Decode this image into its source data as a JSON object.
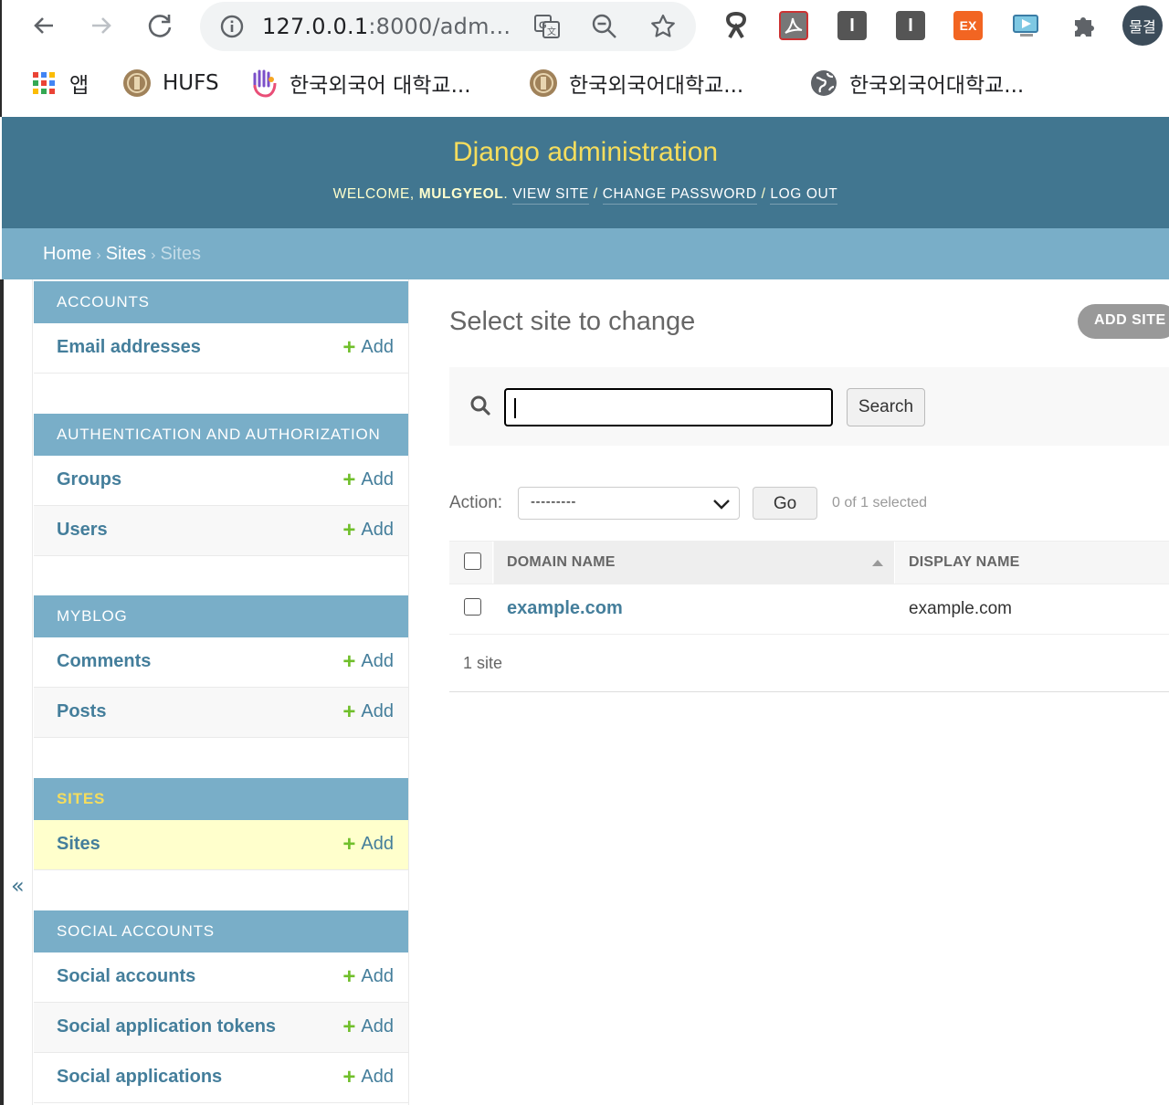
{
  "browser": {
    "url_host": "127.0.0.1",
    "url_rest": ":8000/adm...",
    "profile_label": "물결",
    "bookmarks": [
      {
        "label": "앱",
        "icon": "apps-grid-icon"
      },
      {
        "label": "HUFS",
        "icon": "hufs-logo-icon"
      },
      {
        "label": "한국외국어 대학교...",
        "icon": "hand-logo-icon"
      },
      {
        "label": "한국외국어대학교...",
        "icon": "hufs-logo-icon"
      },
      {
        "label": "한국외국어대학교...",
        "icon": "globe-icon"
      }
    ],
    "extensions": [
      "ribbon-extension-icon",
      "pdf-extension-icon",
      "i-extension-icon",
      "i-extension-icon",
      "ex-extension-icon",
      "screen-extension-icon",
      "puzzle-extension-icon"
    ],
    "ext_labels": {
      "i1": "I",
      "i2": "I",
      "ex": "EX"
    }
  },
  "header": {
    "site_name": "Django administration",
    "welcome": "Welcome,",
    "username": "mulgyeol",
    "view_site": "View site",
    "change_password": "Change password",
    "log_out": "Log out",
    "separator": "/"
  },
  "breadcrumbs": {
    "home": "Home",
    "app": "Sites",
    "current": "Sites",
    "separator": "›"
  },
  "sidebar": {
    "toggle": "«",
    "add_label": "Add",
    "modules": [
      {
        "caption": "Accounts",
        "models": [
          "Email addresses"
        ]
      },
      {
        "caption": "Authentication and Authorization",
        "models": [
          "Groups",
          "Users"
        ]
      },
      {
        "caption": "Myblog",
        "models": [
          "Comments",
          "Posts"
        ]
      },
      {
        "caption": "Sites",
        "models": [
          "Sites"
        ],
        "current": true
      },
      {
        "caption": "Social Accounts",
        "models": [
          "Social accounts",
          "Social application tokens",
          "Social applications"
        ]
      }
    ]
  },
  "content": {
    "title": "Select site to change",
    "add_button": "Add site",
    "search_button": "Search",
    "search_value": "",
    "action_label": "Action:",
    "action_selected": "---------",
    "go_button": "Go",
    "action_counter": "0 of 1 selected",
    "columns": [
      "Domain name",
      "Display name"
    ],
    "rows": [
      {
        "domain": "example.com",
        "display": "example.com"
      }
    ],
    "paginator": "1 site"
  },
  "colors": {
    "header_bg": "#417690",
    "breadcrumb_bg": "#79aec8",
    "module_caption_bg": "#79aec8",
    "link": "#447e9b",
    "site_name": "#f5dd5d",
    "add_plus": "#70bf2b",
    "current_row": "#ffffcc"
  }
}
